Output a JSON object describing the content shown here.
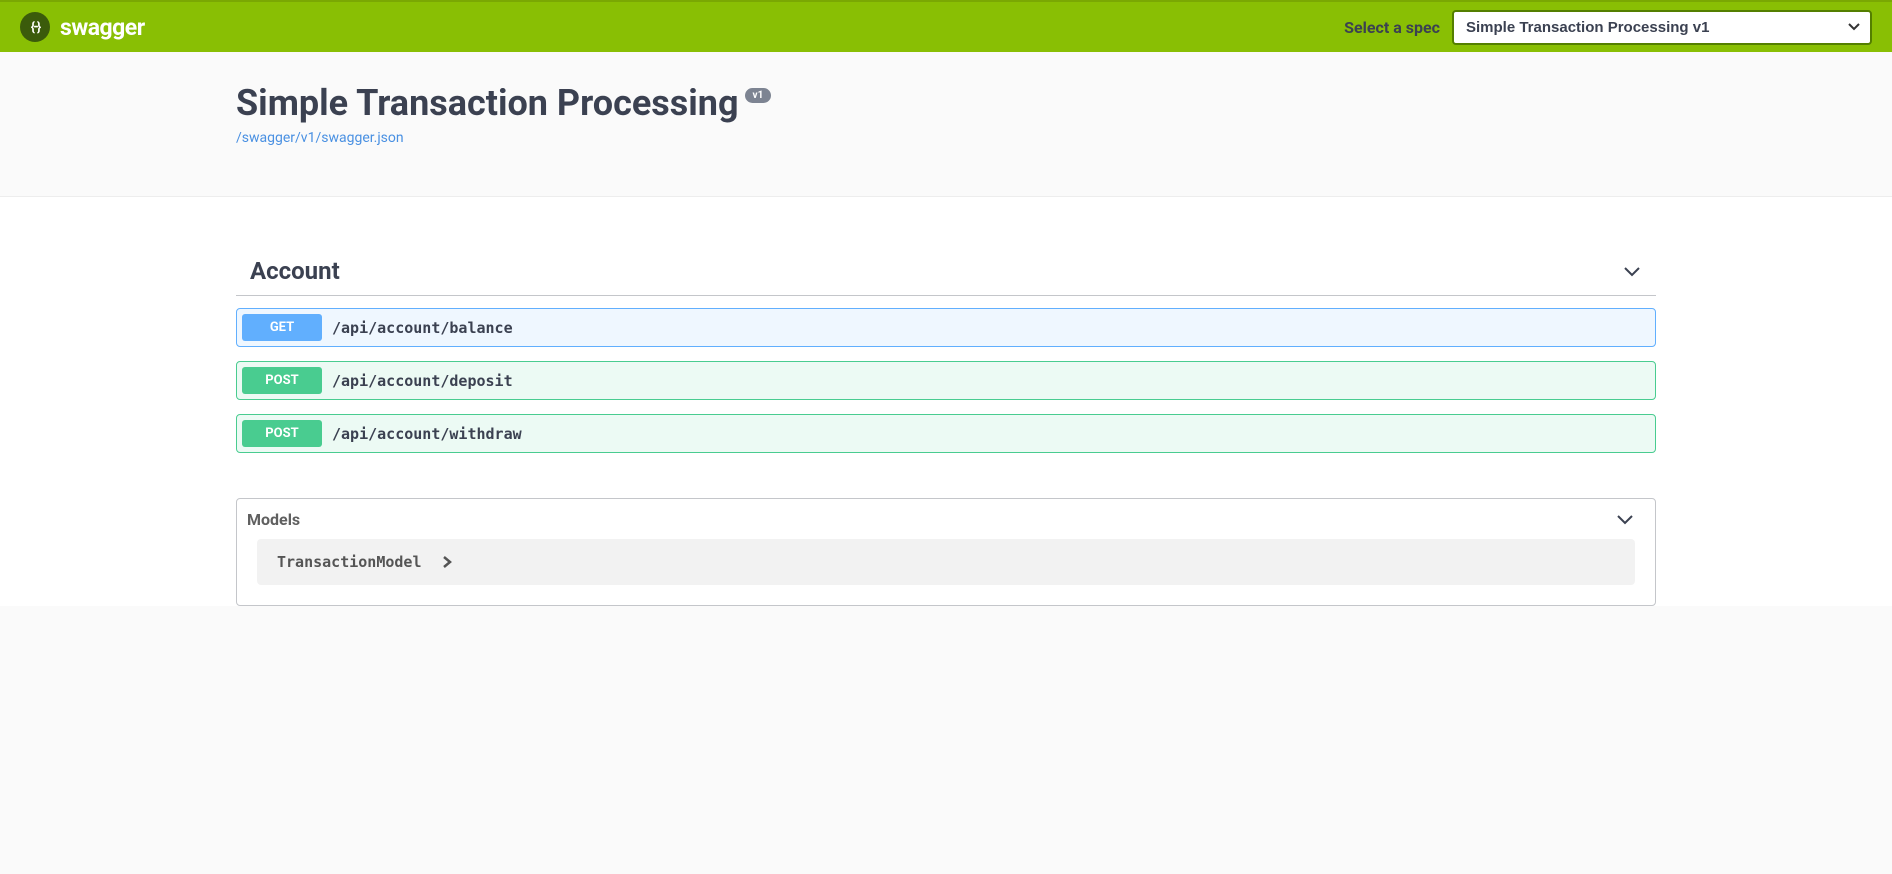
{
  "header": {
    "brand": "swagger",
    "select_label": "Select a spec",
    "selected_spec": "Simple Transaction Processing v1"
  },
  "info": {
    "title": "Simple Transaction Processing",
    "version_badge": "v1",
    "swagger_url": "/swagger/v1/swagger.json"
  },
  "tag": {
    "name": "Account",
    "operations": [
      {
        "method": "GET",
        "path": "/api/account/balance"
      },
      {
        "method": "POST",
        "path": "/api/account/deposit"
      },
      {
        "method": "POST",
        "path": "/api/account/withdraw"
      }
    ]
  },
  "models": {
    "title": "Models",
    "items": [
      {
        "name": "TransactionModel"
      }
    ]
  }
}
